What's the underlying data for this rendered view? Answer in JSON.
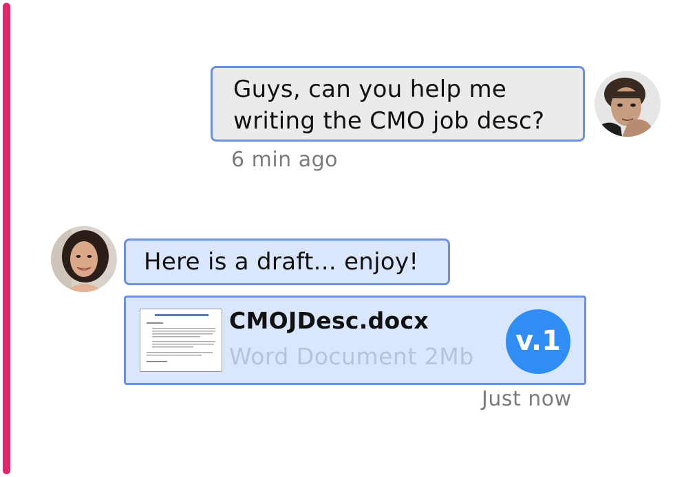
{
  "conversation": {
    "accent_color": "#e0276a",
    "messages": [
      {
        "sender": "user",
        "avatar_icon": "man-portrait-avatar",
        "text_lines": [
          "Guys, can you help me",
          "writing the CMO job desc?"
        ],
        "timestamp": "6 min ago"
      },
      {
        "sender": "friend",
        "avatar_icon": "woman-portrait-avatar",
        "text": "Here is a draft... enjoy!",
        "attachment": {
          "file_name": "CMOJDesc.docx",
          "file_meta": "Word Document 2Mb",
          "version": "v.1",
          "thumbnail_icon": "document-preview"
        },
        "timestamp": "Just now"
      }
    ]
  },
  "colors": {
    "bubble_border": "#6e91de",
    "outgoing_bubble": "#ebebeb",
    "incoming_bubble": "#d9e6fb",
    "version_badge": "#2f8df4"
  }
}
